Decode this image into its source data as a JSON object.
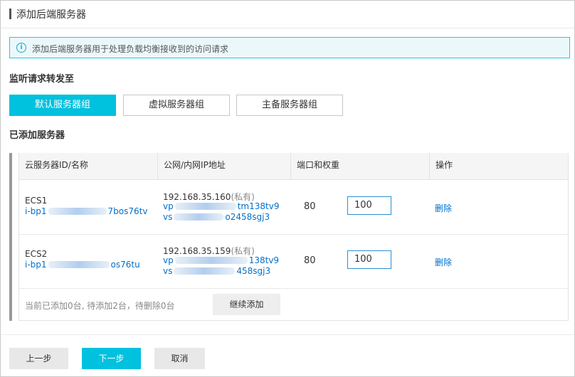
{
  "title": "添加后端服务器",
  "info_banner": {
    "icon": "info-icon",
    "text": "添加后端服务器用于处理负载均衡接收到的访问请求"
  },
  "forward_section": {
    "label": "监听请求转发至",
    "options": [
      "默认服务器组",
      "虚拟服务器组",
      "主备服务器组"
    ],
    "selected": "默认服务器组"
  },
  "added_section": {
    "label": "已添加服务器"
  },
  "table": {
    "headers": [
      "云服务器ID/名称",
      "公网/内网IP地址",
      "端口和权重",
      "操作"
    ],
    "rows": [
      {
        "name": "ECS1",
        "id_prefix": "i-bp1",
        "id_suffix": "7bos76tv",
        "ip": "192.168.35.160",
        "ip_tag": "(私有)",
        "vpc_prefix": "vp",
        "vpc_suffix": "tm138tv9",
        "vsw_prefix": "vs",
        "vsw_suffix": "o2458sgj3",
        "port": "80",
        "weight": "100",
        "action": "删除"
      },
      {
        "name": "ECS2",
        "id_prefix": "i-bp1",
        "id_suffix": "os76tu",
        "ip": "192.168.35.159",
        "ip_tag": "(私有)",
        "vpc_prefix": "vp",
        "vpc_suffix": "138tv9",
        "vsw_prefix": "vs",
        "vsw_suffix": "458sgj3",
        "port": "80",
        "weight": "100",
        "action": "删除"
      }
    ],
    "status_text": "当前已添加0台, 待添加2台，待删除0台",
    "add_more_label": "继续添加"
  },
  "footer": {
    "prev_label": "上一步",
    "next_label": "下一步",
    "cancel_label": "取消"
  },
  "colors": {
    "accent": "#00c1de",
    "link": "#0070cc",
    "banner_border": "#2ec3d8",
    "banner_bg": "#ebf8fb"
  }
}
